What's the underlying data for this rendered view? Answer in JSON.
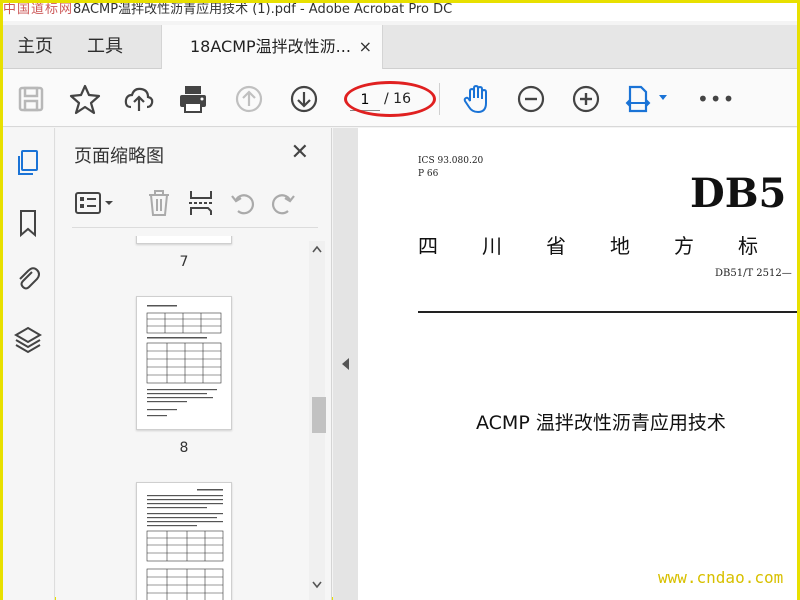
{
  "window": {
    "watermark_site": "中国道标网",
    "title": "8ACMP温拌改性沥青应用技术 (1).pdf - Adobe Acrobat Pro DC"
  },
  "tabs": {
    "home": "主页",
    "tools": "工具",
    "document": "18ACMP温拌改性沥...",
    "close": "×"
  },
  "toolbar": {
    "icons": [
      "save-icon",
      "star-icon",
      "upload-cloud-icon",
      "print-icon",
      "page-up-icon",
      "page-down-icon",
      "hand-tool-icon",
      "zoom-out-icon",
      "zoom-in-icon",
      "fit-page-icon",
      "more-icon"
    ],
    "current_page": "1",
    "total_pages": "/ 16",
    "more": "•••"
  },
  "panel": {
    "title": "页面缩略图",
    "close": "✕",
    "thumbnails": [
      {
        "page_label": "7"
      },
      {
        "page_label": "8"
      },
      {
        "page_label": ""
      }
    ]
  },
  "document": {
    "ics": "ICS 93.080.20",
    "p": "P 66",
    "db": "DB5",
    "province": [
      "四",
      "川",
      "省",
      "地",
      "方",
      "标"
    ],
    "code": "DB51/T 2512—",
    "title": "ACMP 温拌改性沥青应用技术"
  },
  "bottom_watermark": "www.cndao.com",
  "colors": {
    "accent_blue": "#1a73d6",
    "highlight_red": "#e02020",
    "frame_yellow": "#e8e000"
  }
}
